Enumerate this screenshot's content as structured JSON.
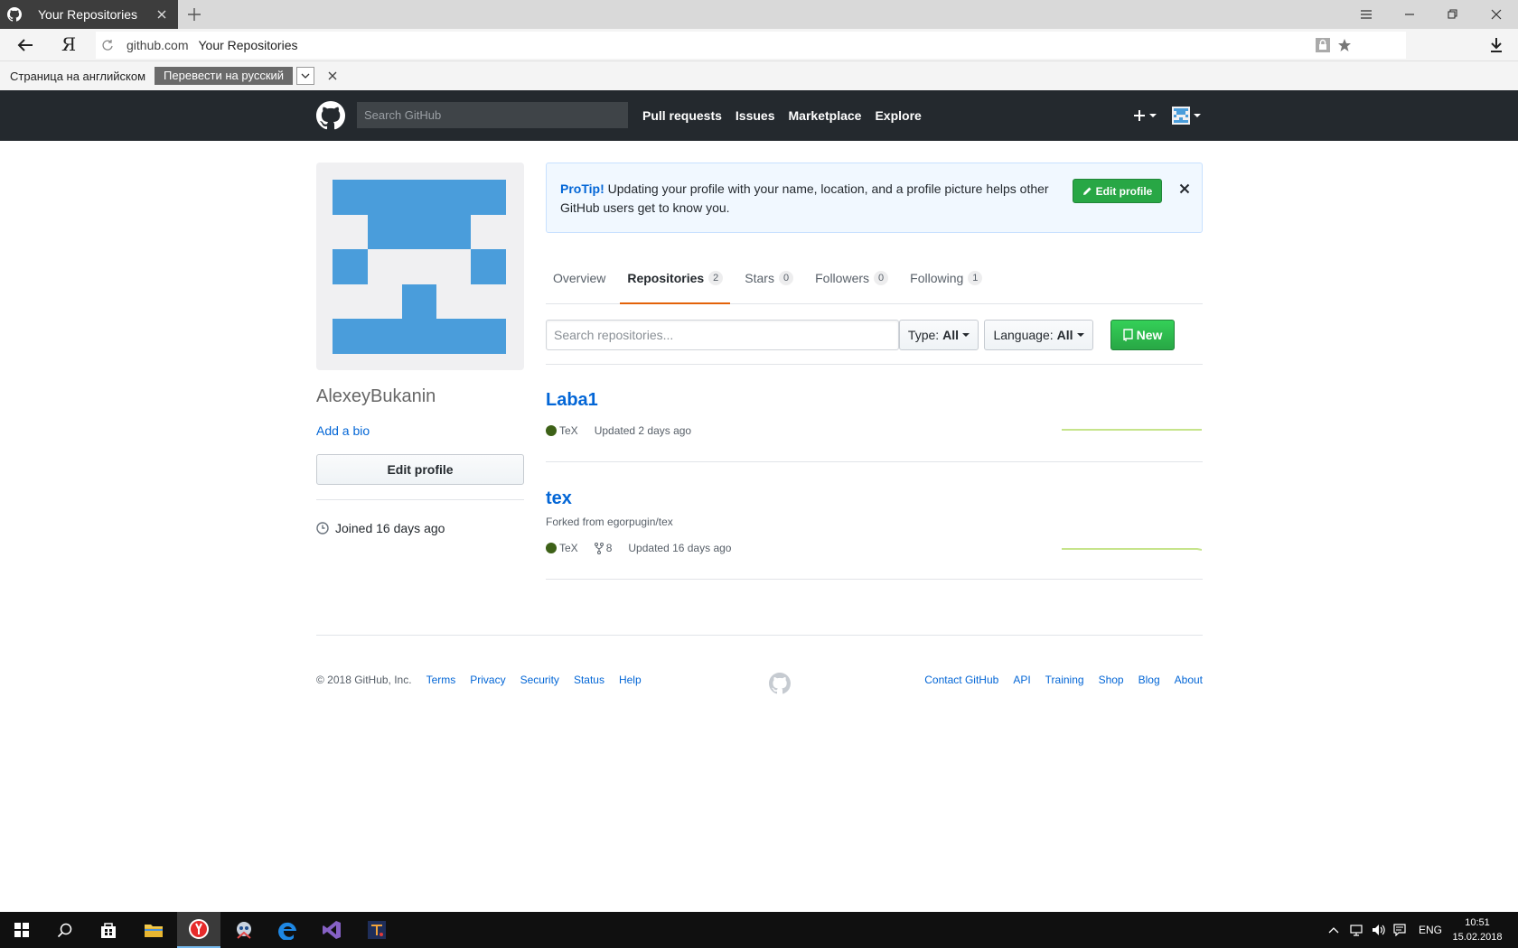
{
  "browser": {
    "tab_title": "Your Repositories",
    "address_domain": "github.com",
    "address_title": "Your Repositories",
    "logo_letter": "Я"
  },
  "translate_bar": {
    "text": "Страница на английском",
    "button_label": "Перевести на русский"
  },
  "github_header": {
    "search_placeholder": "Search GitHub",
    "nav": [
      "Pull requests",
      "Issues",
      "Marketplace",
      "Explore"
    ]
  },
  "profile": {
    "username": "AlexeyBukanin",
    "add_bio": "Add a bio",
    "edit_profile_label": "Edit profile",
    "joined": "Joined 16 days ago",
    "avatar_color": "#4a9ddb"
  },
  "protip": {
    "bold": "ProTip!",
    "text": " Updating your profile with your name, location, and a profile picture helps other GitHub users get to know you.",
    "button_label": "Edit profile"
  },
  "tabs": [
    {
      "label": "Overview",
      "count": null,
      "active": false
    },
    {
      "label": "Repositories",
      "count": "2",
      "active": true
    },
    {
      "label": "Stars",
      "count": "0",
      "active": false
    },
    {
      "label": "Followers",
      "count": "0",
      "active": false
    },
    {
      "label": "Following",
      "count": "1",
      "active": false
    }
  ],
  "filters": {
    "search_placeholder": "Search repositories...",
    "type_label": "Type:",
    "type_value": "All",
    "language_label": "Language:",
    "language_value": "All",
    "new_label": "New"
  },
  "repos": [
    {
      "name": "Laba1",
      "forked_from": "",
      "language": "TeX",
      "language_color": "#3D6117",
      "forks": "",
      "updated": "Updated 2 days ago"
    },
    {
      "name": "tex",
      "forked_from": "Forked from egorpugin/tex",
      "language": "TeX",
      "language_color": "#3D6117",
      "forks": "8",
      "updated": "Updated 16 days ago"
    }
  ],
  "footer": {
    "copyright": "© 2018 GitHub, Inc.",
    "left_links": [
      "Terms",
      "Privacy",
      "Security",
      "Status",
      "Help"
    ],
    "right_links": [
      "Contact GitHub",
      "API",
      "Training",
      "Shop",
      "Blog",
      "About"
    ]
  },
  "taskbar": {
    "language": "ENG",
    "time": "10:51",
    "date": "15.02.2018"
  },
  "colors": {
    "github_header_bg": "#24292e",
    "link_blue": "#0366d6",
    "green_button": "#28a745",
    "active_tab_underline": "#e36209"
  }
}
